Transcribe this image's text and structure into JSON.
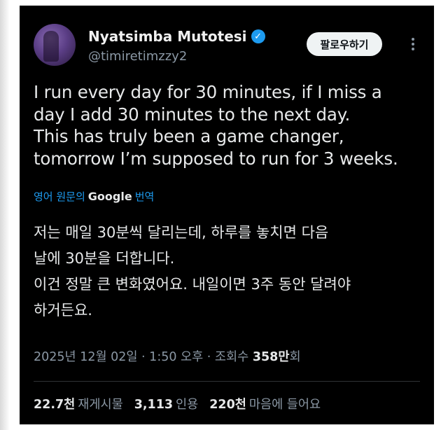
{
  "author": {
    "name": "Nyatsimba Mutotesi",
    "handle": "@timiretimzzy2",
    "verified_icon": "checkmark-icon"
  },
  "follow_button": "팔로우하기",
  "more_icon": "more-options-icon",
  "tweet": {
    "text": "I run every day for 30 minutes, if I miss a\nday I add 30 minutes to the next day.\nThis has truly been a game changer,\ntomorrow I’m supposed to run for 3 weeks."
  },
  "translation": {
    "prefix": "영어 원문의",
    "provider": "Google",
    "suffix": "번역",
    "text": "저는 매일 30분씩 달리는데, 하루를 놓치면 다음\n날에 30분을 더합니다.\n이건 정말 큰 변화였어요. 내일이면 3주 동안 달려야\n하거든요."
  },
  "meta": {
    "timestamp": "2025년 12월 02일 · 1:50 오후 · 조회수 ",
    "views": "358만",
    "views_suffix": "회"
  },
  "stats": [
    {
      "value": "22.7천",
      "label": "재게시물"
    },
    {
      "value": "3,113",
      "label": "인용"
    },
    {
      "value": "220천",
      "label": "마음에 들어요"
    }
  ],
  "colors": {
    "background": "#000000",
    "link": "#1d9bf0",
    "text": "#e7e9ea",
    "secondary": "#8b98a5"
  }
}
